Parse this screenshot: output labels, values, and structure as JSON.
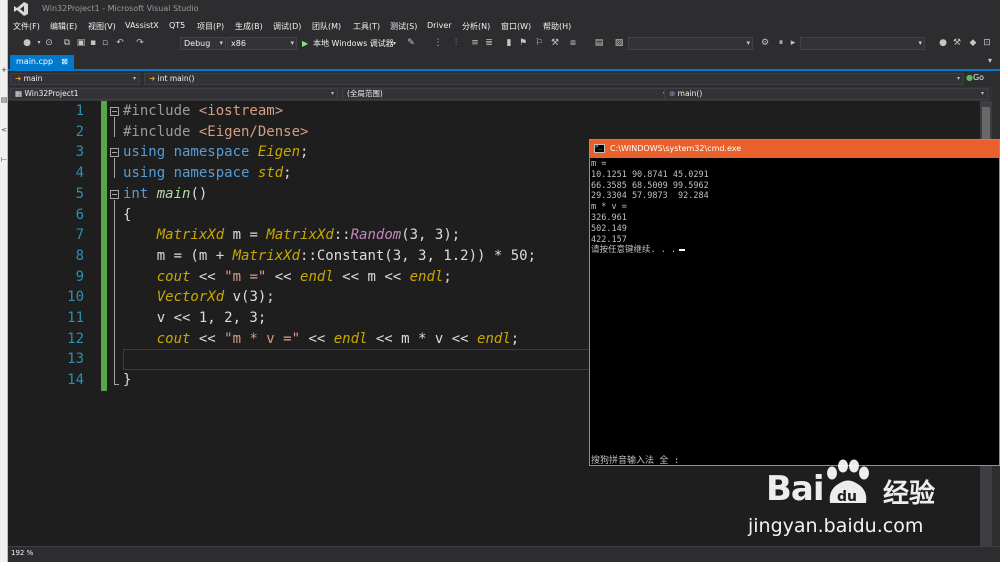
{
  "window": {
    "title": "Win32Project1 - Microsoft Visual Studio"
  },
  "menu": [
    "文件(F)",
    "编辑(E)",
    "视图(V)",
    "VAssistX",
    "QT5",
    "项目(P)",
    "生成(B)",
    "调试(D)",
    "团队(M)",
    "工具(T)",
    "测试(S)",
    "Driver",
    "分析(N)",
    "窗口(W)",
    "帮助(H)"
  ],
  "toolbar": {
    "config": "Debug",
    "platform": "x86",
    "run_label": "本地 Windows 调试器",
    "go_label": "Go"
  },
  "editor_tab": {
    "label": "main.cpp"
  },
  "nav": {
    "scope_left": "main",
    "function": "int main()",
    "project": "Win32Project1",
    "scope": "(全局范围)",
    "member": "main()"
  },
  "code": {
    "line_numbers": [
      "1",
      "2",
      "3",
      "4",
      "5",
      "6",
      "7",
      "8",
      "9",
      "10",
      "11",
      "12",
      "13",
      "14"
    ],
    "lines": [
      [
        {
          "t": "#include ",
          "c": "pp"
        },
        {
          "t": "<iostream>",
          "c": "inc"
        }
      ],
      [
        {
          "t": "#include ",
          "c": "pp"
        },
        {
          "t": "<Eigen/Dense>",
          "c": "inc"
        }
      ],
      [
        {
          "t": "using namespace ",
          "c": "kw"
        },
        {
          "t": "Eigen",
          "c": "ty"
        },
        {
          "t": ";",
          "c": ""
        }
      ],
      [
        {
          "t": "using namespace ",
          "c": "kw"
        },
        {
          "t": "std",
          "c": "ty"
        },
        {
          "t": ";",
          "c": ""
        }
      ],
      [
        {
          "t": "int ",
          "c": "kw"
        },
        {
          "t": "main",
          "c": "fn"
        },
        {
          "t": "()",
          "c": ""
        }
      ],
      [
        {
          "t": "{",
          "c": ""
        }
      ],
      [
        {
          "t": "    ",
          "c": ""
        },
        {
          "t": "MatrixXd",
          "c": "ty"
        },
        {
          "t": " m = ",
          "c": ""
        },
        {
          "t": "MatrixXd",
          "c": "ty"
        },
        {
          "t": "::",
          "c": ""
        },
        {
          "t": "Random",
          "c": "fnp"
        },
        {
          "t": "(3, 3);",
          "c": ""
        }
      ],
      [
        {
          "t": "    m = (m + ",
          "c": ""
        },
        {
          "t": "MatrixXd",
          "c": "ty"
        },
        {
          "t": "::Constant(3, 3, 1.2)) * 50;",
          "c": ""
        }
      ],
      [
        {
          "t": "    ",
          "c": ""
        },
        {
          "t": "cout",
          "c": "ty"
        },
        {
          "t": " << ",
          "c": ""
        },
        {
          "t": "\"m =\"",
          "c": "str"
        },
        {
          "t": " << ",
          "c": ""
        },
        {
          "t": "endl",
          "c": "ty"
        },
        {
          "t": " << m << ",
          "c": ""
        },
        {
          "t": "endl",
          "c": "ty"
        },
        {
          "t": ";",
          "c": ""
        }
      ],
      [
        {
          "t": "    ",
          "c": ""
        },
        {
          "t": "VectorXd",
          "c": "ty"
        },
        {
          "t": " v(3);",
          "c": ""
        }
      ],
      [
        {
          "t": "    v << 1, 2, 3;",
          "c": ""
        }
      ],
      [
        {
          "t": "    ",
          "c": ""
        },
        {
          "t": "cout",
          "c": "ty"
        },
        {
          "t": " << ",
          "c": ""
        },
        {
          "t": "\"m * v =\"",
          "c": "str"
        },
        {
          "t": " << ",
          "c": ""
        },
        {
          "t": "endl",
          "c": "ty"
        },
        {
          "t": " << m * v << ",
          "c": ""
        },
        {
          "t": "endl",
          "c": "ty"
        },
        {
          "t": ";",
          "c": ""
        }
      ],
      [],
      [
        {
          "t": "}",
          "c": ""
        }
      ]
    ]
  },
  "cmd": {
    "title": "C:\\WINDOWS\\system32\\cmd.exe",
    "output": "m =\n10.1251 90.8741 45.0291\n66.3585 68.5009 99.5962\n29.3304 57.9873  92.284\nm * v =\n326.961\n502.149\n422.157\n请按任意键继续. . .",
    "ime_text": "搜狗拼音输入法 全 :"
  },
  "status": {
    "zoom": "192 %"
  },
  "watermark": {
    "logo_text": "Bai",
    "logo_suffix": "du",
    "product": "经验",
    "url": "jingyan.baidu.com"
  },
  "colors": {
    "accent": "#007acc",
    "cmd_title": "#e8602c",
    "line_numbers": "#2b91af",
    "keyword": "#569cd6",
    "type": "#c8a800",
    "string": "#d69d85",
    "change_bar": "#57a64a"
  }
}
